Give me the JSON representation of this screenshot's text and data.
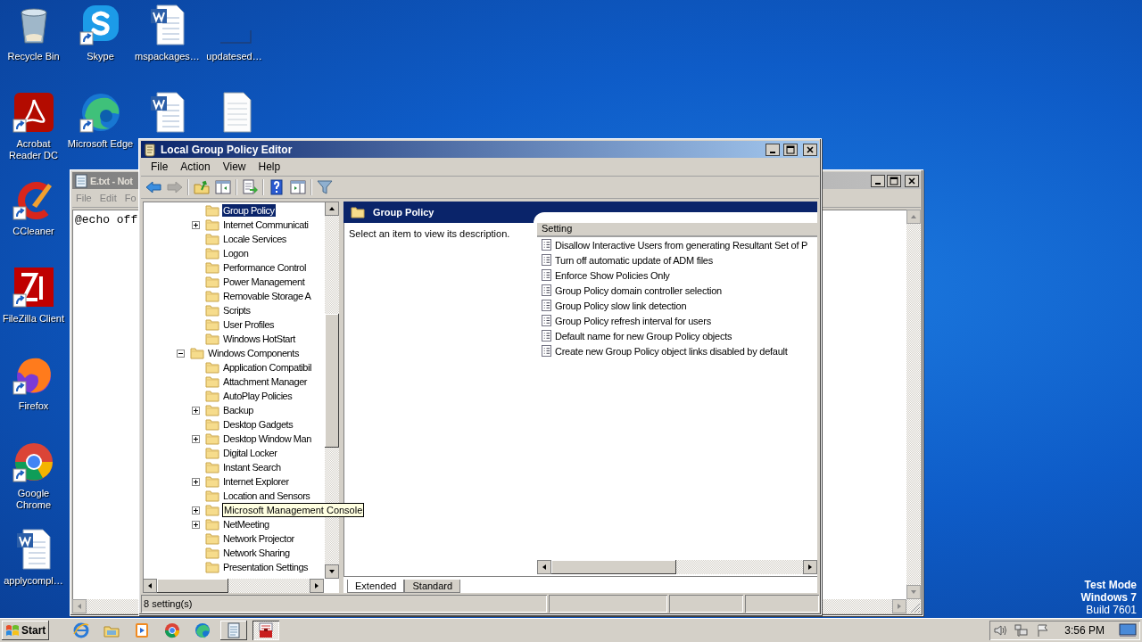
{
  "desktop": {
    "icons": [
      {
        "label": "Recycle Bin",
        "kind": "recycle",
        "shortcut": false
      },
      {
        "label": "Skype",
        "kind": "skype",
        "shortcut": true
      },
      {
        "label": "mspackages…",
        "kind": "word",
        "shortcut": false
      },
      {
        "label": "updatesed…",
        "kind": "blank",
        "shortcut": false
      },
      {
        "label": "Acrobat Reader DC",
        "kind": "acrobat",
        "shortcut": true
      },
      {
        "label": "Microsoft Edge",
        "kind": "edge",
        "shortcut": true
      },
      {
        "kind": "word",
        "shortcut": false
      },
      {
        "kind": "text",
        "shortcut": false
      },
      {
        "label": "CCleaner",
        "kind": "ccleaner",
        "shortcut": true
      },
      {
        "label": "FileZilla Client",
        "kind": "filezilla",
        "shortcut": true
      },
      {
        "label": "Firefox",
        "kind": "firefox",
        "shortcut": true
      },
      {
        "label": "Google Chrome",
        "kind": "chrome",
        "shortcut": true
      },
      {
        "label": "applycompl…",
        "kind": "word",
        "shortcut": false
      }
    ],
    "notice": [
      {
        "text": "Test Mode",
        "emphasis": true
      },
      {
        "text": "Windows 7",
        "emphasis": true
      },
      {
        "text": "Build 7601",
        "emphasis": false
      }
    ]
  },
  "notepad": {
    "title": "E.txt - Not",
    "menu": [
      "File",
      "Edit",
      "Fo"
    ],
    "content": "@echo off",
    "active": false
  },
  "editor": {
    "title": "Local Group Policy Editor",
    "active": true,
    "menu": [
      "File",
      "Action",
      "View",
      "Help"
    ],
    "toolbar": [
      {
        "kind": "back",
        "disabled": false
      },
      {
        "kind": "forward",
        "disabled": true
      },
      {
        "kind": "up",
        "disabled": false
      },
      {
        "kind": "tree",
        "disabled": false
      },
      {
        "kind": "export",
        "disabled": false
      },
      {
        "kind": "help",
        "disabled": false
      },
      {
        "kind": "action-pane",
        "disabled": false
      },
      {
        "kind": "filter",
        "disabled": false
      }
    ],
    "tree": {
      "continued_items": [
        {
          "label": "Group Policy",
          "kind": "leaf",
          "selected": true,
          "tooltip": false
        },
        {
          "label": "Internet Communicati",
          "kind": "branch",
          "expanded": false,
          "selected": false,
          "tooltip": false
        },
        {
          "label": "Locale Services",
          "kind": "leaf",
          "selected": false,
          "tooltip": false
        },
        {
          "label": "Logon",
          "kind": "leaf",
          "selected": false,
          "tooltip": false
        },
        {
          "label": "Performance Control",
          "kind": "leaf",
          "selected": false,
          "tooltip": false
        },
        {
          "label": "Power Management",
          "kind": "leaf",
          "selected": false,
          "tooltip": false
        },
        {
          "label": "Removable Storage A",
          "kind": "leaf",
          "selected": false,
          "tooltip": false
        },
        {
          "label": "Scripts",
          "kind": "leaf",
          "selected": false,
          "tooltip": false
        },
        {
          "label": "User Profiles",
          "kind": "leaf",
          "selected": false,
          "tooltip": false
        },
        {
          "label": "Windows HotStart",
          "kind": "leaf",
          "selected": false,
          "tooltip": false
        }
      ],
      "items": [
        {
          "label": "Windows Components",
          "kind": "branch",
          "expanded": true,
          "selected": false,
          "tooltip": false,
          "children": [
            {
              "label": "Application Compatibil",
              "kind": "leaf",
              "selected": false,
              "tooltip": false
            },
            {
              "label": "Attachment Manager",
              "kind": "leaf",
              "selected": false,
              "tooltip": false
            },
            {
              "label": "AutoPlay Policies",
              "kind": "leaf",
              "selected": false,
              "tooltip": false
            },
            {
              "label": "Backup",
              "kind": "branch",
              "expanded": false,
              "selected": false,
              "tooltip": false
            },
            {
              "label": "Desktop Gadgets",
              "kind": "leaf",
              "selected": false,
              "tooltip": false
            },
            {
              "label": "Desktop Window Man",
              "kind": "branch",
              "expanded": false,
              "selected": false,
              "tooltip": false
            },
            {
              "label": "Digital Locker",
              "kind": "leaf",
              "selected": false,
              "tooltip": false
            },
            {
              "label": "Instant Search",
              "kind": "leaf",
              "selected": false,
              "tooltip": false
            },
            {
              "label": "Internet Explorer",
              "kind": "branch",
              "expanded": false,
              "selected": false,
              "tooltip": false
            },
            {
              "label": "Location and Sensors",
              "kind": "leaf",
              "selected": false,
              "tooltip": false
            },
            {
              "label": "Microsoft Management Console",
              "kind": "branch",
              "expanded": false,
              "selected": false,
              "tooltip": true
            },
            {
              "label": "NetMeeting",
              "kind": "branch",
              "expanded": false,
              "selected": false,
              "tooltip": false
            },
            {
              "label": "Network Projector",
              "kind": "leaf",
              "selected": false,
              "tooltip": false
            },
            {
              "label": "Network Sharing",
              "kind": "leaf",
              "selected": false,
              "tooltip": false
            },
            {
              "label": "Presentation Settings",
              "kind": "leaf",
              "selected": false,
              "tooltip": false
            }
          ]
        }
      ]
    },
    "pane": {
      "heading": "Group Policy",
      "description": "Select an item to view its description.",
      "column": "Setting",
      "settings": [
        "Disallow Interactive Users from generating Resultant Set of P",
        "Turn off automatic update of ADM files",
        "Enforce Show Policies Only",
        "Group Policy domain controller selection",
        "Group Policy slow link detection",
        "Group Policy refresh interval for users",
        "Default name for new Group Policy objects",
        "Create new Group Policy object links disabled by default"
      ],
      "tabs": [
        {
          "label": "Extended",
          "selected": true
        },
        {
          "label": "Standard",
          "selected": false
        }
      ]
    },
    "status_bar": "8 setting(s)"
  },
  "taskbar": {
    "start": "Start",
    "apps": [
      {
        "kind": "ie",
        "open": false,
        "active": false
      },
      {
        "kind": "explorer",
        "open": false,
        "active": false
      },
      {
        "kind": "media",
        "open": false,
        "active": false
      },
      {
        "kind": "chrome",
        "open": false,
        "active": false
      },
      {
        "kind": "edge",
        "open": false,
        "active": false
      },
      {
        "kind": "notepad",
        "open": true,
        "active": false
      },
      {
        "kind": "gpedit",
        "open": true,
        "active": true
      }
    ],
    "time": "3:56 PM"
  }
}
